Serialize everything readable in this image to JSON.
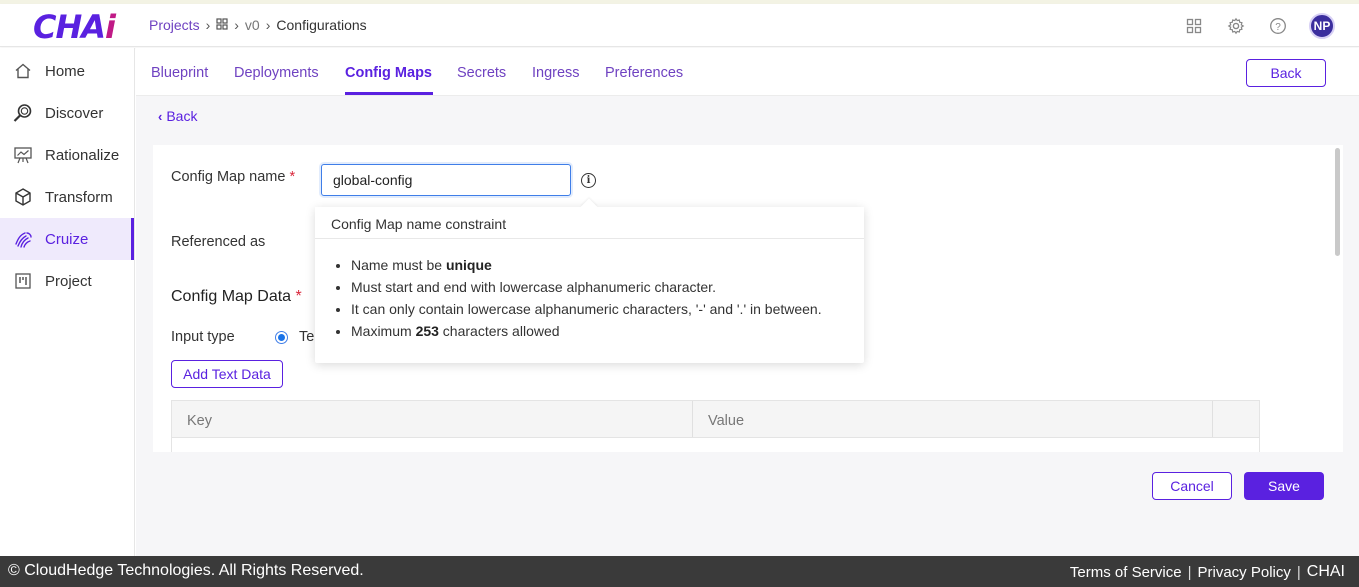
{
  "app": {
    "logo_main": "CHA",
    "logo_accent": "i"
  },
  "breadcrumb": {
    "projects": "Projects",
    "version": "v0",
    "current": "Configurations"
  },
  "header": {
    "avatar_initials": "NP"
  },
  "sidebar": {
    "items": [
      {
        "label": "Home",
        "icon": "home-icon"
      },
      {
        "label": "Discover",
        "icon": "search-icon"
      },
      {
        "label": "Rationalize",
        "icon": "presentation-icon"
      },
      {
        "label": "Transform",
        "icon": "cube-icon"
      },
      {
        "label": "Cruize",
        "icon": "fingerprint-icon",
        "active": true
      },
      {
        "label": "Project",
        "icon": "board-icon"
      }
    ]
  },
  "tabs": {
    "items": [
      "Blueprint",
      "Deployments",
      "Config Maps",
      "Secrets",
      "Ingress",
      "Preferences"
    ],
    "active": "Config Maps",
    "back_label": "Back"
  },
  "page": {
    "back_link": "Back",
    "name_label": "Config Map name",
    "name_value": "global-config",
    "referenced_label": "Referenced as",
    "data_label": "Config Map Data",
    "input_type_label": "Input type",
    "radio_text_partial": "Te",
    "add_text_label": "Add Text Data",
    "table_headers": [
      "Key",
      "Value"
    ]
  },
  "popover": {
    "title": "Config Map name constraint",
    "rules": [
      {
        "pre": "Name must be ",
        "bold": "unique",
        "post": ""
      },
      {
        "pre": "Must start and end with lowercase alphanumeric character.",
        "bold": "",
        "post": ""
      },
      {
        "pre": "It can only contain lowercase alphanumeric characters, '-' and '.' in between.",
        "bold": "",
        "post": ""
      },
      {
        "pre": "Maximum ",
        "bold": "253",
        "post": " characters allowed"
      }
    ]
  },
  "actions": {
    "cancel_label": "Cancel",
    "save_label": "Save"
  },
  "footer": {
    "copyright": "© CloudHedge Technologies. All Rights Reserved.",
    "links": [
      "Terms of Service",
      "Privacy Policy",
      "CHAI"
    ]
  },
  "colors": {
    "accent": "#5a21e0",
    "logo_accent": "#c01a86",
    "footer_bg": "#3a3a3a"
  }
}
